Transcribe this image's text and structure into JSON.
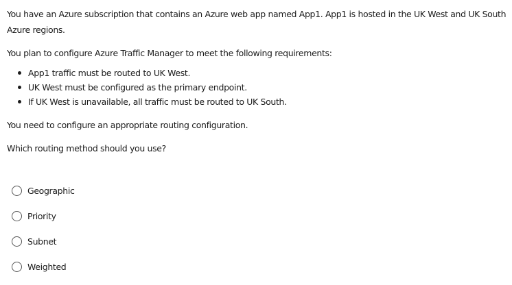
{
  "question": {
    "intro": "You have an Azure subscription that contains an Azure web app named App1. App1 is hosted in the UK West and UK South Azure regions.",
    "plan": "You plan to configure Azure Traffic Manager to meet the following requirements:",
    "requirements": [
      "App1 traffic must be routed to UK West.",
      "UK West must be configured as the primary endpoint.",
      "If UK West is unavailable, all traffic must be routed to UK South."
    ],
    "need": "You need to configure an appropriate routing configuration.",
    "ask": "Which routing method should you use?"
  },
  "options": [
    {
      "label": "Geographic",
      "selected": false
    },
    {
      "label": "Priority",
      "selected": false
    },
    {
      "label": "Subnet",
      "selected": false
    },
    {
      "label": "Weighted",
      "selected": false
    }
  ]
}
